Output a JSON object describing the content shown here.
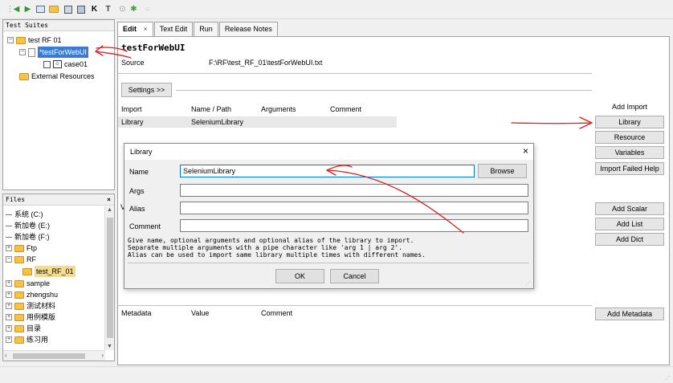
{
  "toolbar": {
    "icons": [
      "back-arrow-icon",
      "forward-arrow-icon",
      "open-suite-icon",
      "folder-icon",
      "save-icon",
      "save-all-icon",
      "keyword-icon",
      "text-icon",
      "run-icon",
      "stop-icon",
      "circle-icon"
    ]
  },
  "tree": {
    "title": "Test Suites",
    "items": [
      {
        "label": "test RF 01"
      },
      {
        "label": "*testForWebUI"
      },
      {
        "label": "case01"
      },
      {
        "label": "External Resources"
      }
    ]
  },
  "files": {
    "title": "Files",
    "close": "×",
    "items": [
      {
        "label": "系统 (C:)"
      },
      {
        "label": "新加卷 (E:)"
      },
      {
        "label": "新加卷 (F:)"
      },
      {
        "label": "Ftp"
      },
      {
        "label": "RF"
      },
      {
        "label": "test_RF_01"
      },
      {
        "label": "sample"
      },
      {
        "label": "zhengshu"
      },
      {
        "label": "测试材料"
      },
      {
        "label": "用例模版"
      },
      {
        "label": "目录"
      },
      {
        "label": "练习用"
      }
    ]
  },
  "tabs": [
    {
      "label": "Edit",
      "close": "×"
    },
    {
      "label": "Text Edit"
    },
    {
      "label": "Run"
    },
    {
      "label": "Release Notes"
    }
  ],
  "editor": {
    "suite_name": "testForWebUI",
    "source_label": "Source",
    "source_value": "F:\\RF\\test_RF_01\\testForWebUI.txt",
    "settings_button": "Settings >>",
    "import_headers": [
      "Import",
      "Name / Path",
      "Arguments",
      "Comment"
    ],
    "import_rows": [
      {
        "import": "Library",
        "name": "SeleniumLibrary"
      }
    ],
    "variables_initial": "V",
    "metadata_headers": [
      "Metadata",
      "Value",
      "Comment"
    ]
  },
  "side": {
    "add_import_label": "Add Import",
    "library": "Library",
    "resource": "Resource",
    "variables": "Variables",
    "import_failed_help": "Import Failed Help",
    "add_scalar": "Add Scalar",
    "add_list": "Add List",
    "add_dict": "Add Dict",
    "add_metadata": "Add Metadata"
  },
  "dialog": {
    "title": "Library",
    "close": "×",
    "name_label": "Name",
    "name_value": "SeleniumLibrary",
    "browse": "Browse",
    "args_label": "Args",
    "alias_label": "Alias",
    "comment_label": "Comment",
    "help": "Give name, optional arguments and optional alias of the library to import.\nSeparate multiple arguments with a pipe character like 'arg 1 | arg 2'.\nAlias can be used to import same library multiple times with different names.",
    "ok": "OK",
    "cancel": "Cancel"
  },
  "colors": {
    "selection": "#3b7bd3",
    "annotation_red": "#d81f1f",
    "focus_border": "#0078d7"
  }
}
